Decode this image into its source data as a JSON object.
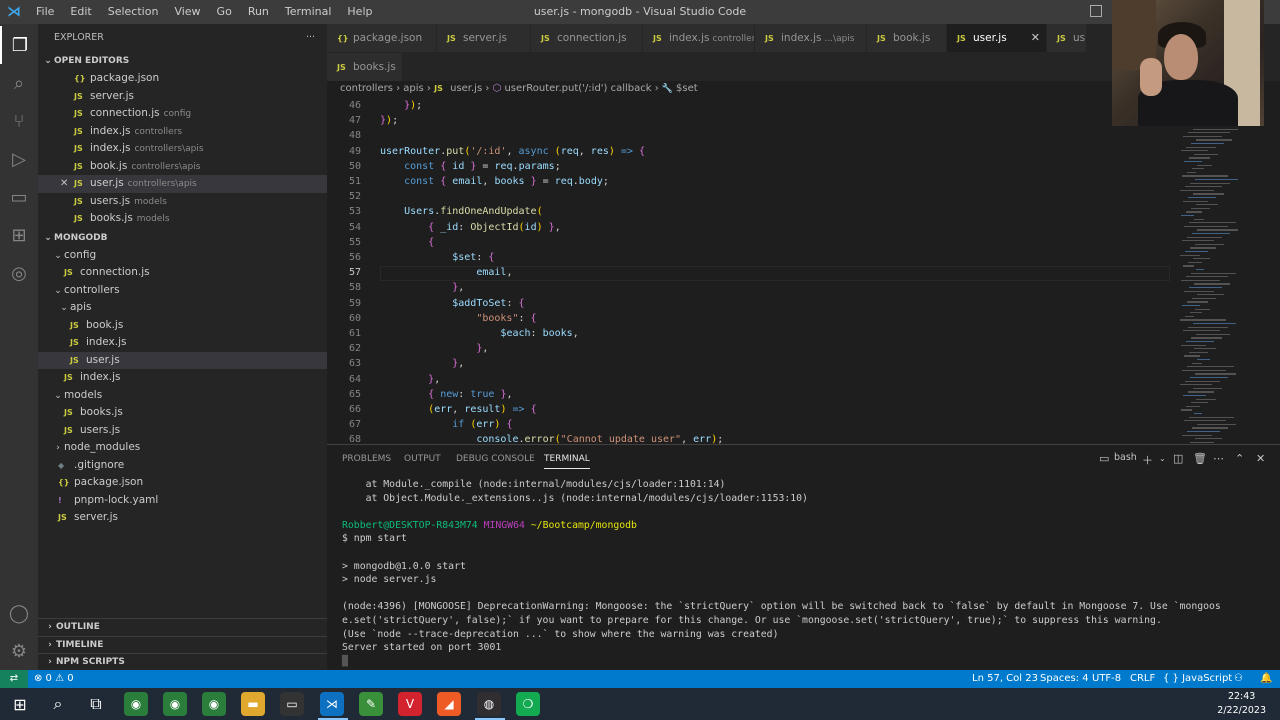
{
  "window": {
    "title": "user.js - mongodb - Visual Studio Code",
    "menu": [
      "File",
      "Edit",
      "Selection",
      "View",
      "Go",
      "Run",
      "Terminal",
      "Help"
    ]
  },
  "activity_bar": {
    "items": [
      "explorer-icon",
      "search-icon",
      "source-control-icon",
      "run-debug-icon",
      "remote-explorer-icon",
      "extensions-icon",
      "git-graph-icon"
    ],
    "bottom": [
      "account-icon",
      "settings-gear-icon"
    ]
  },
  "sidebar": {
    "title": "EXPLORER",
    "more": "···",
    "open_editors": {
      "label": "OPEN EDITORS",
      "items": [
        {
          "icon": "{}",
          "name": "package.json",
          "desc": ""
        },
        {
          "icon": "JS",
          "name": "server.js",
          "desc": ""
        },
        {
          "icon": "JS",
          "name": "connection.js",
          "desc": "config"
        },
        {
          "icon": "JS",
          "name": "index.js",
          "desc": "controllers"
        },
        {
          "icon": "JS",
          "name": "index.js",
          "desc": "controllers\\apis"
        },
        {
          "icon": "JS",
          "name": "book.js",
          "desc": "controllers\\apis"
        },
        {
          "icon": "JS",
          "name": "user.js",
          "desc": "controllers\\apis"
        },
        {
          "icon": "JS",
          "name": "users.js",
          "desc": "models"
        },
        {
          "icon": "JS",
          "name": "books.js",
          "desc": "models"
        }
      ],
      "close_glyph": "✕"
    },
    "project": {
      "label": "MONGODB",
      "tree": [
        {
          "type": "folder",
          "name": "config",
          "depth": 1,
          "open": true
        },
        {
          "type": "js",
          "name": "connection.js",
          "depth": 2
        },
        {
          "type": "folder",
          "name": "controllers",
          "depth": 1,
          "open": true
        },
        {
          "type": "folder",
          "name": "apis",
          "depth": 2,
          "open": true
        },
        {
          "type": "js",
          "name": "book.js",
          "depth": 3
        },
        {
          "type": "js",
          "name": "index.js",
          "depth": 3
        },
        {
          "type": "js",
          "name": "user.js",
          "depth": 3
        },
        {
          "type": "js",
          "name": "index.js",
          "depth": 2
        },
        {
          "type": "folder",
          "name": "models",
          "depth": 1,
          "open": true
        },
        {
          "type": "js",
          "name": "books.js",
          "depth": 2
        },
        {
          "type": "js",
          "name": "users.js",
          "depth": 2
        },
        {
          "type": "folder",
          "name": "node_modules",
          "depth": 1,
          "open": false
        },
        {
          "type": "git",
          "name": ".gitignore",
          "depth": 1
        },
        {
          "type": "json",
          "name": "package.json",
          "depth": 1
        },
        {
          "type": "yaml",
          "name": "pnpm-lock.yaml",
          "depth": 1
        },
        {
          "type": "js",
          "name": "server.js",
          "depth": 1
        }
      ]
    },
    "outline": "OUTLINE",
    "timeline": "TIMELINE",
    "npm_scripts": "NPM SCRIPTS"
  },
  "tabs": [
    {
      "icon": "{}",
      "name": "package.json",
      "desc": ""
    },
    {
      "icon": "JS",
      "name": "server.js",
      "desc": ""
    },
    {
      "icon": "JS",
      "name": "connection.js",
      "desc": ""
    },
    {
      "icon": "JS",
      "name": "index.js",
      "desc": "controllers"
    },
    {
      "icon": "JS",
      "name": "index.js",
      "desc": "...\\apis"
    },
    {
      "icon": "JS",
      "name": "book.js",
      "desc": ""
    },
    {
      "icon": "JS",
      "name": "user.js",
      "desc": "",
      "active": true
    },
    {
      "icon": "JS",
      "name": "us",
      "desc": ""
    }
  ],
  "tabs_row2": [
    {
      "icon": "JS",
      "name": "books.js"
    }
  ],
  "breadcrumb": [
    "controllers",
    "apis",
    "user.js",
    "userRouter.put('/:id') callback",
    "$set"
  ],
  "editor": {
    "current_line": 57,
    "lines": [
      {
        "n": 46,
        "code": "    });"
      },
      {
        "n": 47,
        "code": "});"
      },
      {
        "n": 48,
        "code": ""
      },
      {
        "n": 49,
        "code": "userRouter.put('/:id', async (req, res) => {"
      },
      {
        "n": 50,
        "code": "    const { id } = req.params;"
      },
      {
        "n": 51,
        "code": "    const { email, books } = req.body;"
      },
      {
        "n": 52,
        "code": ""
      },
      {
        "n": 53,
        "code": "    Users.findOneAndUpdate("
      },
      {
        "n": 54,
        "code": "        { _id: ObjectId(id) },"
      },
      {
        "n": 55,
        "code": "        {"
      },
      {
        "n": 56,
        "code": "            $set: {"
      },
      {
        "n": 57,
        "code": "                email,"
      },
      {
        "n": 58,
        "code": "            },"
      },
      {
        "n": 59,
        "code": "            $addToSet: {"
      },
      {
        "n": 60,
        "code": "                \"books\": {"
      },
      {
        "n": 61,
        "code": "                    $each: books,"
      },
      {
        "n": 62,
        "code": "                },"
      },
      {
        "n": 63,
        "code": "            },"
      },
      {
        "n": 64,
        "code": "        },"
      },
      {
        "n": 65,
        "code": "        { new: true },"
      },
      {
        "n": 66,
        "code": "        (err, result) => {"
      },
      {
        "n": 67,
        "code": "            if (err) {"
      },
      {
        "n": 68,
        "code": "                console.error(\"Cannot update user\", err);"
      }
    ]
  },
  "panel": {
    "tabs": [
      "PROBLEMS",
      "OUTPUT",
      "DEBUG CONSOLE",
      "TERMINAL"
    ],
    "active_tab": "TERMINAL",
    "shell": "bash",
    "terminal_lines": [
      "    at Module._compile (node:internal/modules/cjs/loader:1101:14)",
      "    at Object.Module._extensions..js (node:internal/modules/cjs/loader:1153:10)",
      "",
      "PROMPT",
      "$ npm start",
      "",
      "> mongodb@1.0.0 start",
      "> node server.js",
      "",
      "(node:4396) [MONGOOSE] DeprecationWarning: Mongoose: the `strictQuery` option will be switched back to `false` by default in Mongoose 7. Use `mongoos",
      "e.set('strictQuery', false);` if you want to prepare for this change. Or use `mongoose.set('strictQuery', true);` to suppress this warning.",
      "(Use `node --trace-deprecation ...` to show where the warning was created)",
      "Server started on port 3001",
      "█"
    ],
    "prompt": {
      "user": "Robbert@DESKTOP-R843M74",
      "env": "MINGW64",
      "path": "~/Bootcamp/mongodb"
    }
  },
  "statusbar": {
    "remote": "⇄",
    "problems": "⊗ 0 ⚠ 0",
    "position": "Ln 57, Col 23",
    "spaces": "Spaces: 4",
    "encoding": "UTF-8",
    "eol": "CRLF",
    "language": "{ } JavaScript",
    "colors": {
      "bar": "#007acc",
      "remote": "#16825d"
    }
  },
  "taskbar": {
    "apps": [
      "windows-start-icon",
      "search-icon",
      "task-view-icon",
      "chrome-icon",
      "chrome-icon",
      "chrome-icon",
      "file-explorer-icon",
      "terminal-icon",
      "vscode-icon",
      "notepad-icon",
      "vivaldi-icon",
      "postman-icon",
      "obs-icon",
      "mongodb-compass-icon"
    ],
    "time": "22:43",
    "date": "2/22/2023"
  }
}
